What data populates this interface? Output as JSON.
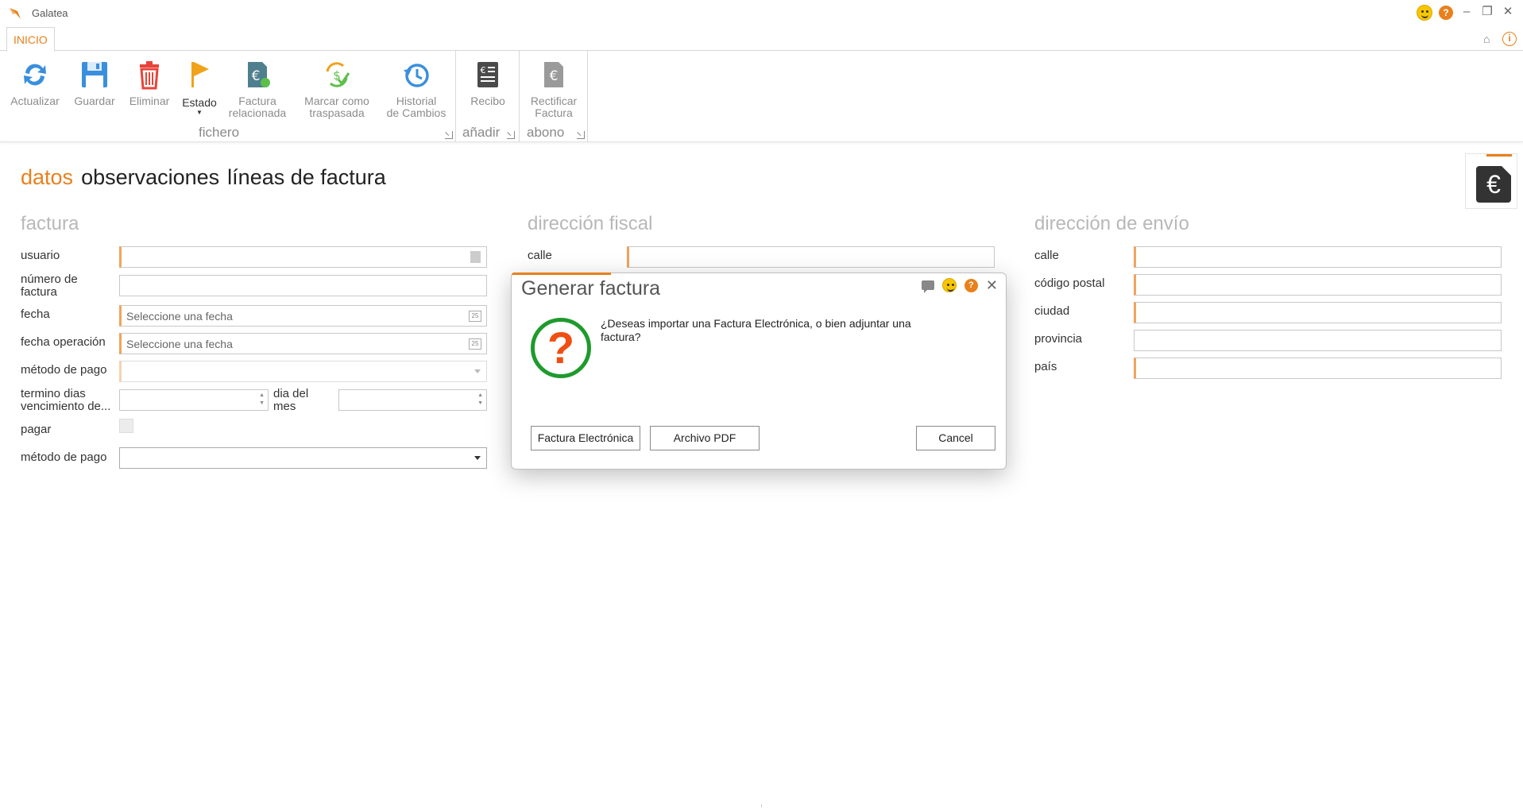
{
  "app": {
    "title": "Galatea"
  },
  "ribbon": {
    "tab": "INICIO",
    "buttons": {
      "actualizar": "Actualizar",
      "guardar": "Guardar",
      "eliminar": "Eliminar",
      "estado": "Estado",
      "factura_relacionada": [
        "Factura",
        "relacionada"
      ],
      "marcar_traspasada": [
        "Marcar como",
        "traspasada"
      ],
      "historial": [
        "Historial",
        "de Cambios"
      ],
      "recibo": "Recibo",
      "rectificar": [
        "Rectificar",
        "Factura"
      ]
    },
    "groups": {
      "fichero": "fichero",
      "anadir": "añadir",
      "abono": "abono"
    }
  },
  "content_tabs": [
    {
      "label": "datos",
      "active": true
    },
    {
      "label": "observaciones",
      "active": false
    },
    {
      "label": "líneas de factura",
      "active": false
    }
  ],
  "factura": {
    "title": "factura",
    "usuario": "usuario",
    "numero": [
      "número de",
      "factura"
    ],
    "fecha": "fecha",
    "fecha_placeholder": "Seleccione una fecha",
    "fecha_operacion": "fecha operación",
    "fecha_operacion_placeholder": "Seleccione una fecha",
    "metodo_pago": "método de pago",
    "termino": [
      "termino dias",
      "vencimiento de..."
    ],
    "dia_mes": [
      "dia del",
      "mes"
    ],
    "pagar": "pagar",
    "metodo_pago_2": "método de pago",
    "cal_icon_text": "25"
  },
  "direccion_fiscal": {
    "title": "dirección fiscal",
    "calle": "calle"
  },
  "direccion_envio": {
    "title": "dirección de envío",
    "calle": "calle",
    "codigo_postal": "código postal",
    "ciudad": "ciudad",
    "provincia": "provincia",
    "pais": "país"
  },
  "dialog": {
    "title": "Generar factura",
    "message": "¿Deseas importar una Factura Electrónica, o bien adjuntar una factura?",
    "buttons": {
      "electronica": "Factura Electrónica",
      "pdf": "Archivo PDF",
      "cancel": "Cancel"
    }
  },
  "colors": {
    "accent": "#e8801c",
    "ribbon_blue": "#3a8fdc",
    "red": "#e8443a",
    "green": "#1f9a2c"
  }
}
